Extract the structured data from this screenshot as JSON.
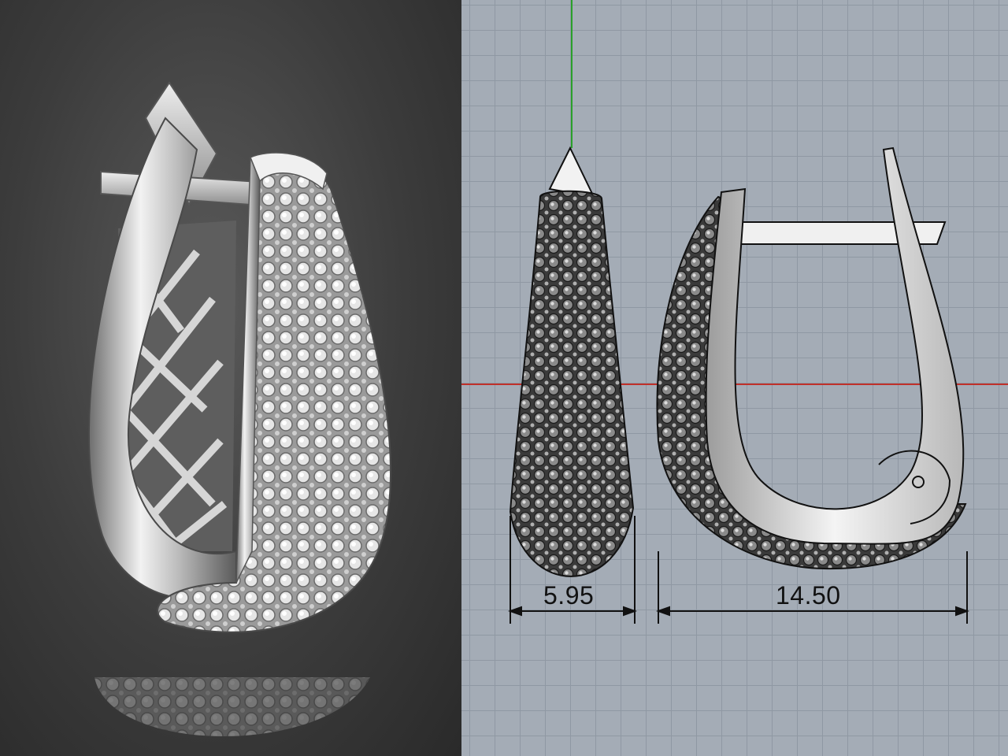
{
  "render": {
    "background_color": "#3a3a3a",
    "metal_color": "#d8d8d8"
  },
  "viewport": {
    "background_color": "#a4acb6",
    "grid_color": "#8f98a3",
    "x_axis_color": "#c0302a",
    "y_axis_color": "#2aa02a",
    "dimensions": {
      "front_width": "5.95",
      "side_width": "14.50"
    }
  }
}
